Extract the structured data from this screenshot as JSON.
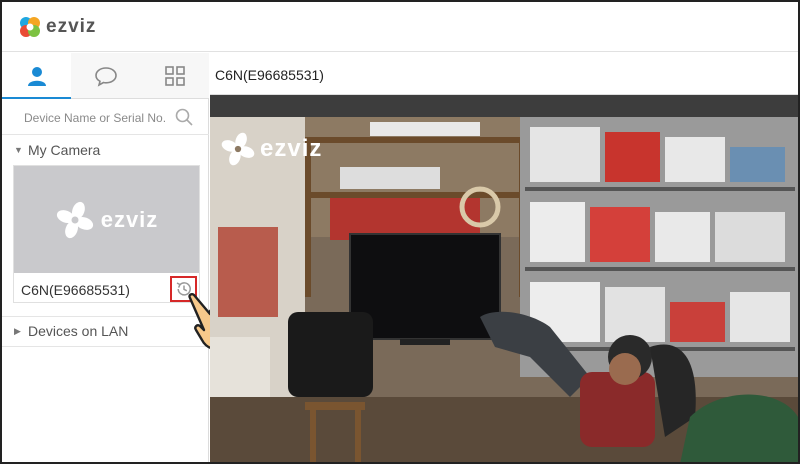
{
  "app": {
    "brand": "ezviz"
  },
  "sidebar": {
    "tabs": [
      {
        "name": "user-icon",
        "active": true
      },
      {
        "name": "message-icon",
        "active": false
      },
      {
        "name": "grid-icon",
        "active": false
      }
    ],
    "search": {
      "placeholder": "Device Name or Serial No."
    },
    "sections": {
      "my_camera": "My Camera",
      "devices_on_lan": "Devices on LAN"
    },
    "camera_card": {
      "thumbnail_brand": "ezviz",
      "name": "C6N(E96685531)",
      "action_icon": "playback-clock-icon"
    }
  },
  "main": {
    "device_title": "C6N(E96685531)",
    "video_watermark": "ezviz"
  },
  "colors": {
    "accent": "#1a8ad4",
    "highlight": "#d62828",
    "hand": "#f7c98b"
  }
}
